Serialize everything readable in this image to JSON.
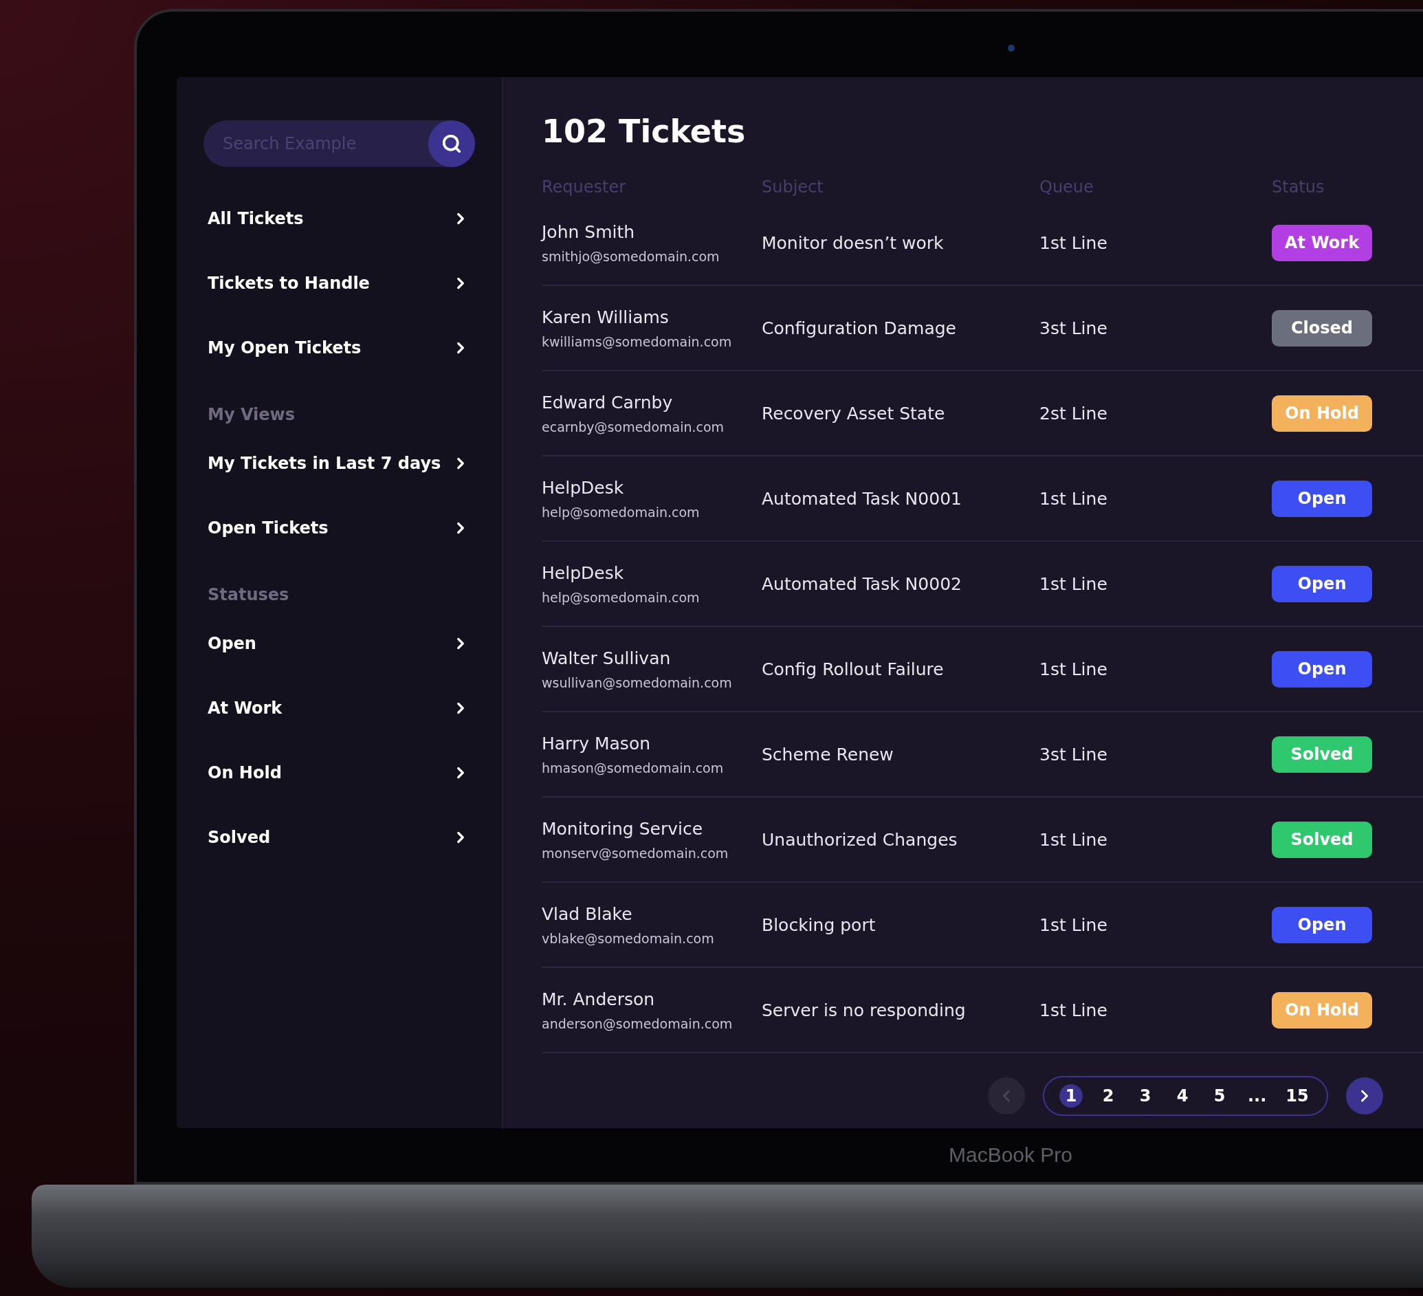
{
  "search": {
    "placeholder": "Search Example"
  },
  "sidebar": {
    "sections": [
      {
        "items": [
          "All Tickets",
          "Tickets to Handle",
          "My Open Tickets"
        ]
      },
      {
        "heading": "My Views",
        "items": [
          "My Tickets in Last 7 days",
          "Open Tickets"
        ]
      },
      {
        "heading": "Statuses",
        "items": [
          "Open",
          "At Work",
          "On Hold",
          "Solved"
        ]
      }
    ]
  },
  "title": "102 Tickets",
  "table": {
    "columns": [
      "Requester",
      "Subject",
      "Queue",
      "Status"
    ],
    "rows": [
      {
        "name": "John Smith",
        "email": "smithjo@somedomain.com",
        "subject": "Monitor doesn’t work",
        "queue": "1st Line",
        "status": {
          "label": "At Work",
          "color": "#b23fe3"
        }
      },
      {
        "name": "Karen Williams",
        "email": "kwilliams@somedomain.com",
        "subject": "Configuration Damage",
        "queue": "3st Line",
        "status": {
          "label": "Closed",
          "color": "#6b6f7d"
        }
      },
      {
        "name": "Edward Carnby",
        "email": "ecarnby@somedomain.com",
        "subject": "Recovery Asset State",
        "queue": "2st Line",
        "status": {
          "label": "On Hold",
          "color": "#f4b15c"
        }
      },
      {
        "name": "HelpDesk",
        "email": "help@somedomain.com",
        "subject": "Automated Task N0001",
        "queue": "1st Line",
        "status": {
          "label": "Open",
          "color": "#3d4ff2"
        }
      },
      {
        "name": "HelpDesk",
        "email": "help@somedomain.com",
        "subject": "Automated Task N0002",
        "queue": "1st Line",
        "status": {
          "label": "Open",
          "color": "#3d4ff2"
        }
      },
      {
        "name": "Walter Sullivan",
        "email": "wsullivan@somedomain.com",
        "subject": "Config Rollout Failure",
        "queue": "1st Line",
        "status": {
          "label": "Open",
          "color": "#3d4ff2"
        }
      },
      {
        "name": "Harry Mason",
        "email": "hmason@somedomain.com",
        "subject": "Scheme Renew",
        "queue": "3st Line",
        "status": {
          "label": "Solved",
          "color": "#2fc86e"
        }
      },
      {
        "name": "Monitoring Service",
        "email": "monserv@somedomain.com",
        "subject": "Unauthorized Changes",
        "queue": "1st Line",
        "status": {
          "label": "Solved",
          "color": "#2fc86e"
        }
      },
      {
        "name": "Vlad Blake",
        "email": "vblake@somedomain.com",
        "subject": "Blocking port",
        "queue": "1st Line",
        "status": {
          "label": "Open",
          "color": "#3d4ff2"
        }
      },
      {
        "name": "Mr. Anderson",
        "email": "anderson@somedomain.com",
        "subject": "Server is no responding",
        "queue": "1st Line",
        "status": {
          "label": "On Hold",
          "color": "#f4b15c"
        }
      }
    ]
  },
  "pagination": {
    "prev_disabled": true,
    "next_disabled": false,
    "pages": [
      {
        "label": "1",
        "selected": true
      },
      {
        "label": "2",
        "selected": false
      },
      {
        "label": "3",
        "selected": false
      },
      {
        "label": "4",
        "selected": false
      },
      {
        "label": "5",
        "selected": false
      },
      {
        "label": "...",
        "selected": false
      },
      {
        "label": "15",
        "selected": false
      }
    ]
  },
  "device_label": "MacBook Pro"
}
